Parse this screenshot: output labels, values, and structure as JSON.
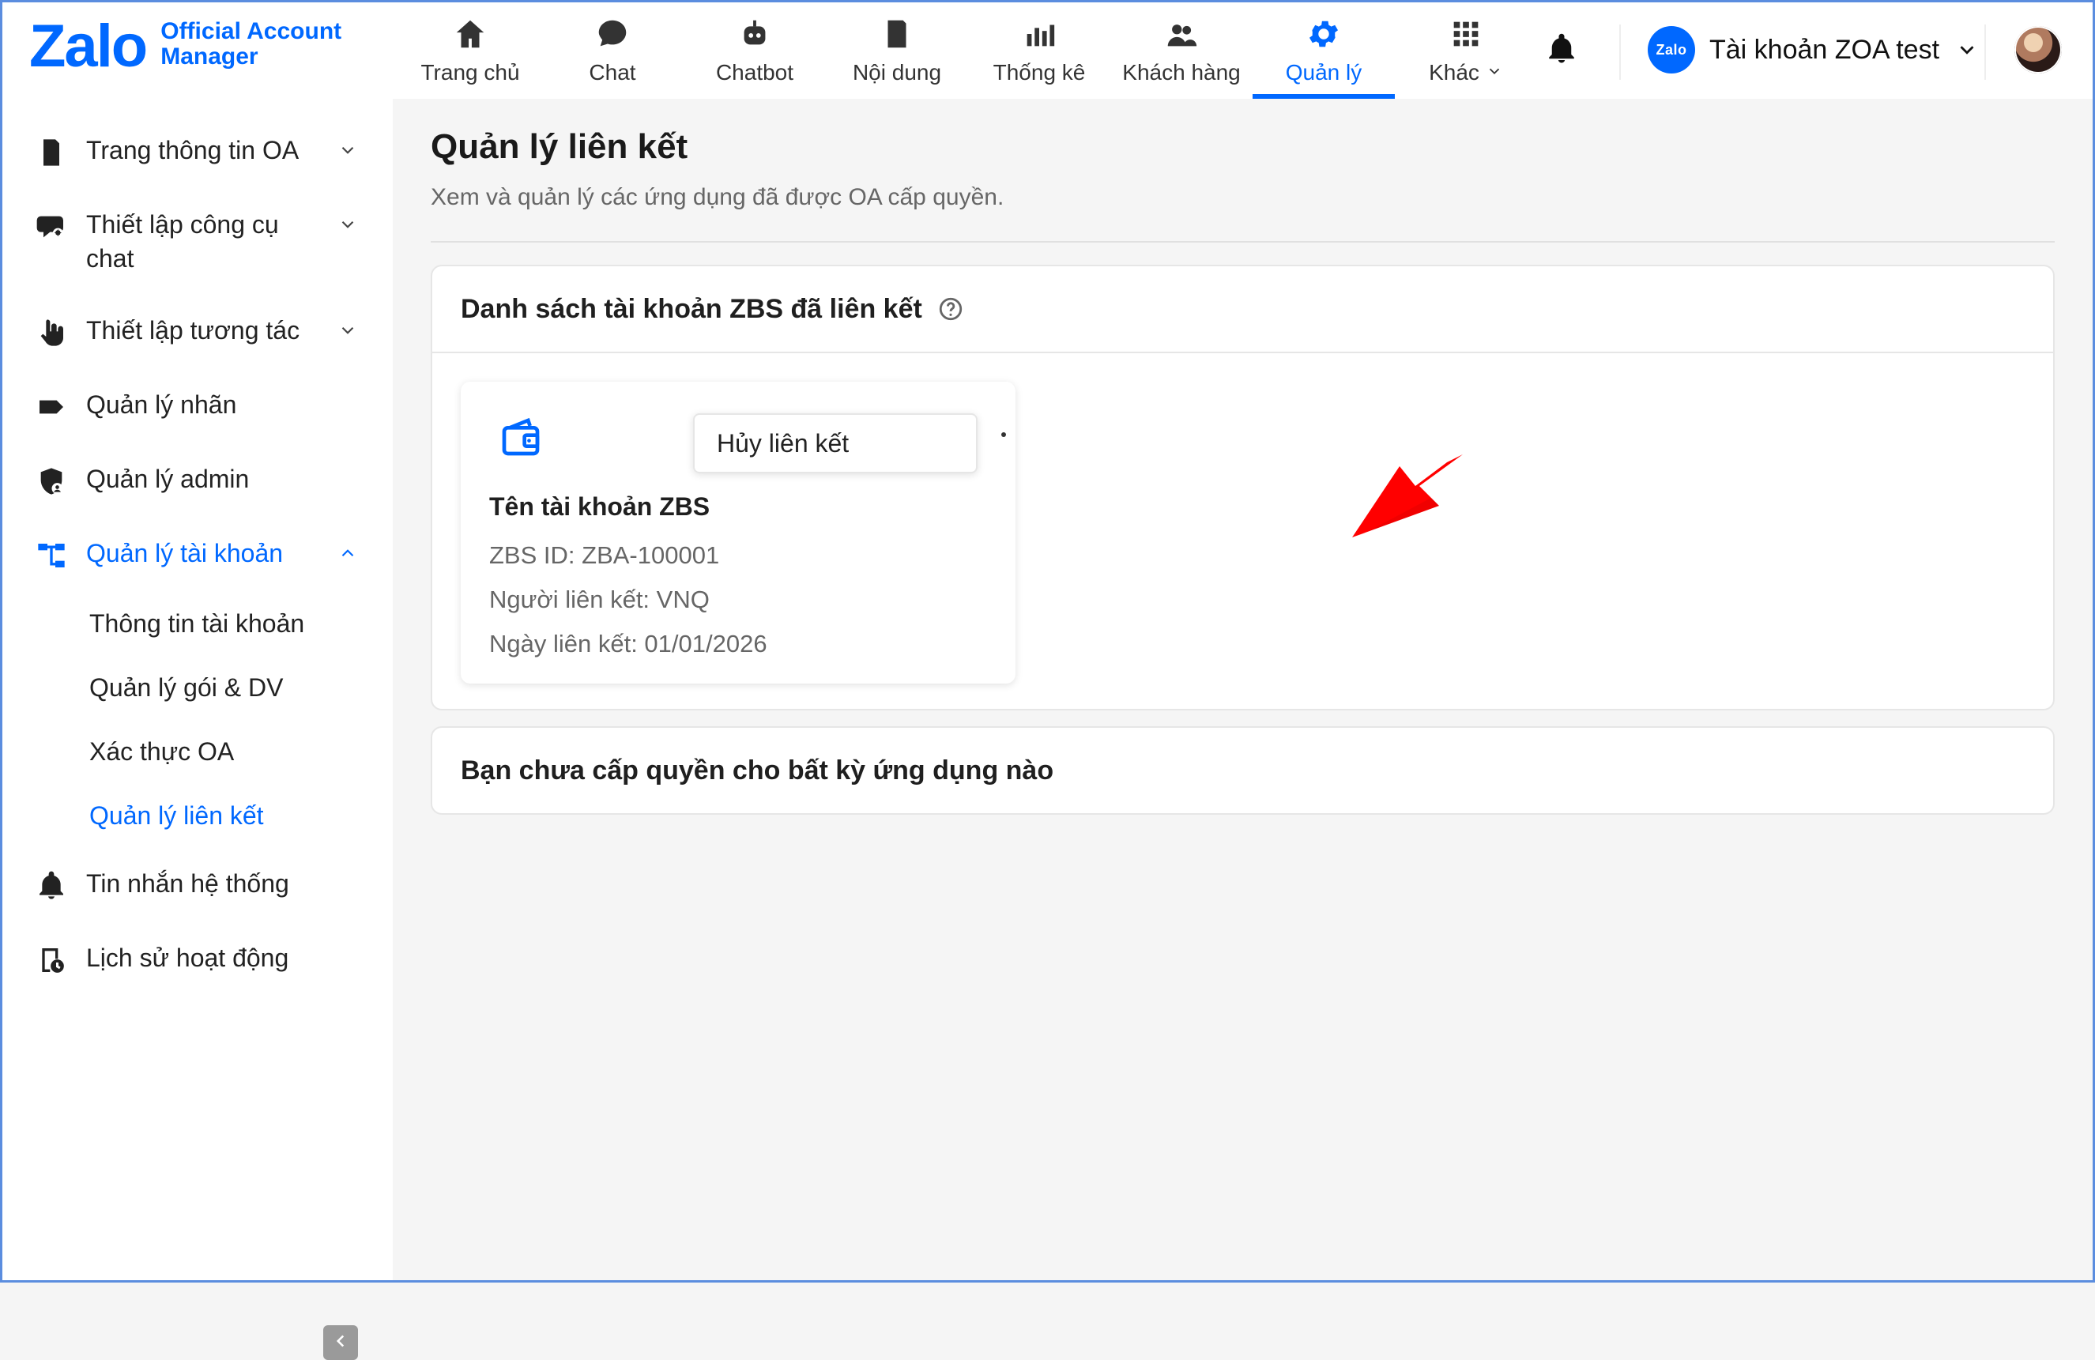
{
  "brand": {
    "logo_text": "Zalo",
    "logo_sub_line1": "Official Account",
    "logo_sub_line2": "Manager",
    "colors": {
      "brand": "#0068ff",
      "active_bg": "#e8f1ff",
      "arrow": "#ff0000"
    }
  },
  "topnav": {
    "items": [
      {
        "id": "home",
        "label": "Trang chủ",
        "icon": "home-icon"
      },
      {
        "id": "chat",
        "label": "Chat",
        "icon": "chat-icon"
      },
      {
        "id": "chatbot",
        "label": "Chatbot",
        "icon": "chatbot-icon"
      },
      {
        "id": "content",
        "label": "Nội dung",
        "icon": "content-icon"
      },
      {
        "id": "stats",
        "label": "Thống kê",
        "icon": "stats-icon"
      },
      {
        "id": "customers",
        "label": "Khách hàng",
        "icon": "customers-icon"
      },
      {
        "id": "manage",
        "label": "Quản lý",
        "icon": "gear-icon"
      },
      {
        "id": "more",
        "label": "Khác",
        "icon": "apps-icon"
      }
    ],
    "active_id": "manage"
  },
  "account": {
    "badge": "Zalo",
    "name": "Tài khoản ZOA test"
  },
  "sidebar": {
    "items": [
      {
        "id": "oa-info",
        "label": "Trang thông tin OA",
        "icon": "document-icon",
        "expandable": true,
        "expanded": false
      },
      {
        "id": "chat-tools",
        "label": "Thiết lập công cụ chat",
        "icon": "chat-settings-icon",
        "expandable": true,
        "expanded": false
      },
      {
        "id": "interaction",
        "label": "Thiết lập tương tác",
        "icon": "tap-icon",
        "expandable": true,
        "expanded": false
      },
      {
        "id": "labels",
        "label": "Quản lý nhãn",
        "icon": "tag-icon",
        "expandable": false
      },
      {
        "id": "admins",
        "label": "Quản lý admin",
        "icon": "shield-user-icon",
        "expandable": false
      },
      {
        "id": "accounts",
        "label": "Quản lý tài khoản",
        "icon": "hierarchy-icon",
        "expandable": true,
        "expanded": true
      }
    ],
    "account_subitems": [
      {
        "id": "acct-info",
        "label": "Thông tin tài khoản"
      },
      {
        "id": "plans",
        "label": "Quản lý gói & DV"
      },
      {
        "id": "verify",
        "label": "Xác thực OA"
      },
      {
        "id": "links",
        "label": "Quản lý liên kết",
        "selected": true
      }
    ],
    "bottom_items": [
      {
        "id": "system-msgs",
        "label": "Tin nhắn hệ thống",
        "icon": "bell-icon"
      },
      {
        "id": "activity",
        "label": "Lịch sử hoạt động",
        "icon": "history-icon"
      }
    ]
  },
  "page": {
    "title": "Quản lý liên kết",
    "subtitle": "Xem và quản lý các ứng dụng đã được OA cấp quyền."
  },
  "linked_accounts": {
    "title": "Danh sách tài khoản ZBS đã liên kết",
    "card": {
      "name": "Tên tài khoản ZBS",
      "zbs_id": "ZBS ID: ZBA-100001",
      "linked_by": "Người liên kết: VNQ",
      "linked_date": "Ngày liên kết: 01/01/2026",
      "menu_action": "Hủy liên kết"
    }
  },
  "no_apps": {
    "title": "Bạn chưa cấp quyền cho bất kỳ ứng dụng nào"
  }
}
